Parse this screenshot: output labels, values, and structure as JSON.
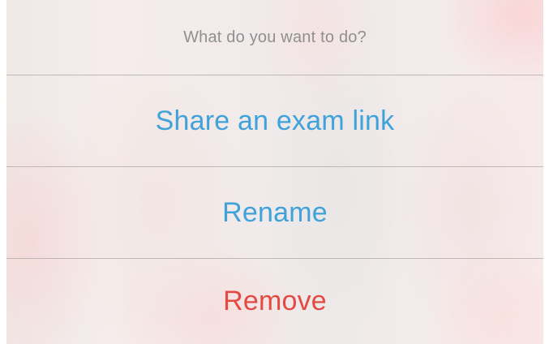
{
  "action_sheet": {
    "title": "What do you want to do?",
    "actions": [
      {
        "label": "Share an exam link",
        "color": "#40a2da"
      },
      {
        "label": "Rename",
        "color": "#40a2da"
      },
      {
        "label": "Remove",
        "color": "#e34a43",
        "destructive": true
      }
    ]
  }
}
